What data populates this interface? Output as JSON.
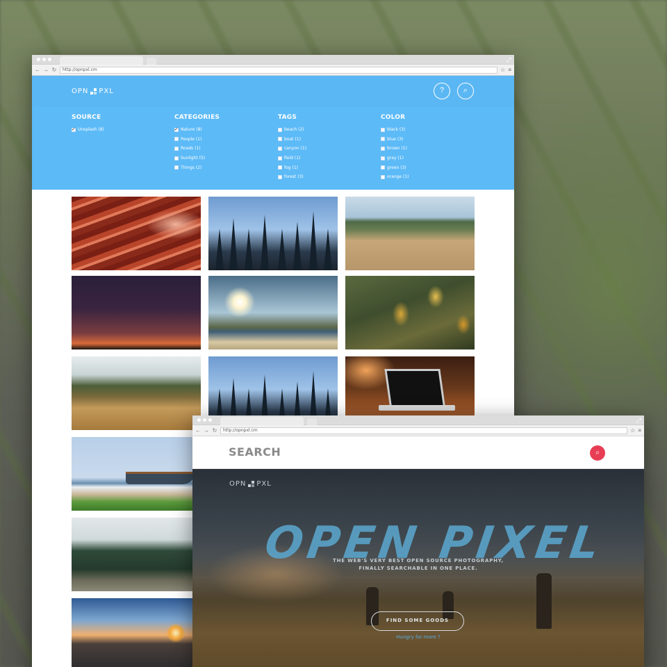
{
  "back_browser": {
    "url": "http://opnpxl.cm",
    "logo": "OPN PXL",
    "help_icon": "?",
    "filters": {
      "source": {
        "heading": "SOURCE",
        "items": [
          {
            "label": "Unsplash (8)",
            "checked": true
          }
        ]
      },
      "categories": {
        "heading": "CATEGORIES",
        "items": [
          {
            "label": "Nature (8)",
            "checked": true
          },
          {
            "label": "People (1)",
            "checked": false
          },
          {
            "label": "Roads (1)",
            "checked": false
          },
          {
            "label": "Sunlight (5)",
            "checked": false
          },
          {
            "label": "Things (2)",
            "checked": false
          }
        ]
      },
      "tags": {
        "heading": "TAGS",
        "items": [
          {
            "label": "beach (2)",
            "checked": false
          },
          {
            "label": "boat (1)",
            "checked": false
          },
          {
            "label": "canyon (1)",
            "checked": false
          },
          {
            "label": "field (1)",
            "checked": false
          },
          {
            "label": "fog (1)",
            "checked": false
          },
          {
            "label": "forest (3)",
            "checked": false
          }
        ]
      },
      "color": {
        "heading": "COLOR",
        "items": [
          {
            "label": "black (3)",
            "checked": false
          },
          {
            "label": "blue (3)",
            "checked": false
          },
          {
            "label": "brown (1)",
            "checked": false
          },
          {
            "label": "gray (1)",
            "checked": false
          },
          {
            "label": "green (3)",
            "checked": false
          },
          {
            "label": "orange (1)",
            "checked": false
          }
        ]
      }
    },
    "colors": {
      "header_blue": "#5bb7f3",
      "filter_blue": "#5cbaf7"
    }
  },
  "front_browser": {
    "url": "http://opnpxl.cm",
    "search_title": "SEARCH",
    "logo": "OPN PXL",
    "hero_title": "OPEN PIXEL",
    "hero_subtitle_line1": "THE WEB'S VERY BEST OPEN SOURCE PHOTOGRAPHY,",
    "hero_subtitle_line2": "FINALLY SEARCHABLE IN ONE PLACE.",
    "cta_label": "FIND SOME GOODS",
    "more_link": "Hungry for more ?",
    "colors": {
      "search_button": "#e83e55",
      "title": "#5aa3c9"
    }
  }
}
